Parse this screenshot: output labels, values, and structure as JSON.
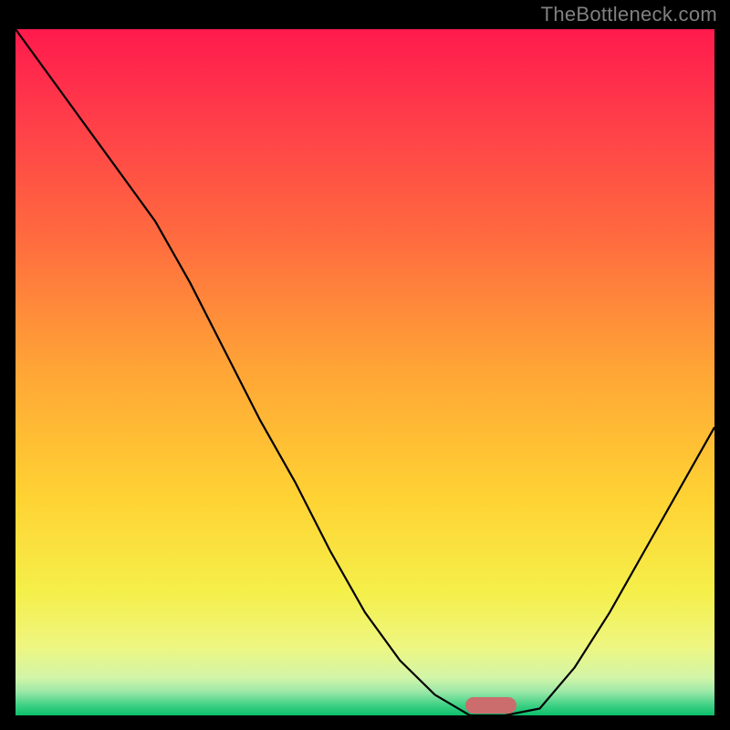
{
  "watermark": "TheBottleneck.com",
  "chart_data": {
    "type": "line",
    "title": "",
    "xlabel": "",
    "ylabel": "",
    "xlim": [
      0,
      100
    ],
    "ylim": [
      0,
      100
    ],
    "x": [
      0,
      5,
      10,
      15,
      20,
      25,
      30,
      35,
      40,
      45,
      50,
      55,
      60,
      65,
      70,
      75,
      80,
      85,
      90,
      95,
      100
    ],
    "y": [
      100,
      93,
      86,
      79,
      72,
      63,
      53,
      43,
      34,
      24,
      15,
      8,
      3,
      0,
      0,
      1,
      7,
      15,
      24,
      33,
      42
    ],
    "gradient_stops": [
      {
        "pos": 0.0,
        "color": "#ff1a4d"
      },
      {
        "pos": 0.12,
        "color": "#ff3a4a"
      },
      {
        "pos": 0.3,
        "color": "#ff6a3f"
      },
      {
        "pos": 0.5,
        "color": "#ffa636"
      },
      {
        "pos": 0.68,
        "color": "#ffd233"
      },
      {
        "pos": 0.82,
        "color": "#f5ef4a"
      },
      {
        "pos": 0.9,
        "color": "#eef681"
      },
      {
        "pos": 0.945,
        "color": "#d2f5a8"
      },
      {
        "pos": 0.965,
        "color": "#9de8a8"
      },
      {
        "pos": 0.985,
        "color": "#3fd185"
      },
      {
        "pos": 1.0,
        "color": "#0cbf6a"
      }
    ],
    "highlight_marker": {
      "x": 68,
      "color": "#cc6d6d"
    }
  }
}
